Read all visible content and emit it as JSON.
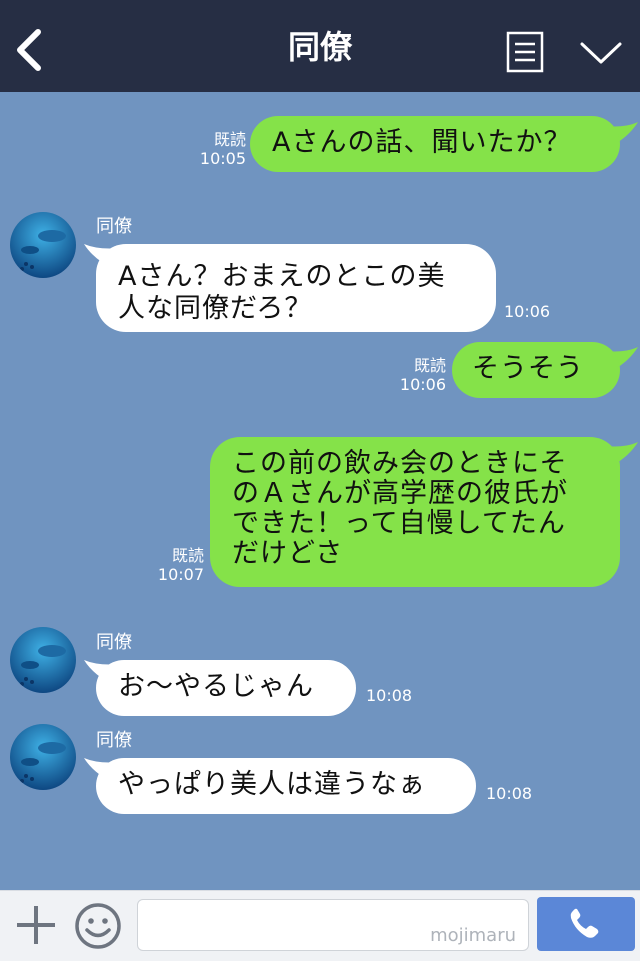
{
  "header": {
    "title": "同僚",
    "back_icon": "chevron-left-icon",
    "menu_icon": "list-menu-icon",
    "more_icon": "chevron-down-icon"
  },
  "messages": [
    {
      "side": "me",
      "text": "Aさんの話、聞いたか？",
      "read": "既読",
      "time": "10:05"
    },
    {
      "side": "other",
      "sender": "同僚",
      "lines": [
        "Aさん？おまえのとこの美",
        "人な同僚だろ？"
      ],
      "time": "10:06"
    },
    {
      "side": "me",
      "text": "そうそう",
      "read": "既読",
      "time": "10:06"
    },
    {
      "side": "me",
      "lines": [
        "この前の飲み会のときにそ",
        "のＡさんが高学歴の彼氏が",
        "できた！って自慢してたん",
        "だけどさ"
      ],
      "read": "既読",
      "time": "10:07"
    },
    {
      "side": "other",
      "sender": "同僚",
      "text": "お〜やるじゃん",
      "time": "10:08"
    },
    {
      "side": "other",
      "sender": "同僚",
      "text": "やっぱり美人は違うなぁ",
      "time": "10:08"
    }
  ],
  "footer": {
    "plus_icon": "plus-icon",
    "emoji_icon": "smiley-icon",
    "input_value": "",
    "watermark": "mojimaru",
    "call_icon": "phone-icon"
  },
  "colors": {
    "background": "#7094c0",
    "header": "#262e44",
    "my_bubble": "#85e249",
    "their_bubble": "#ffffff",
    "call_button": "#5b87d7"
  }
}
